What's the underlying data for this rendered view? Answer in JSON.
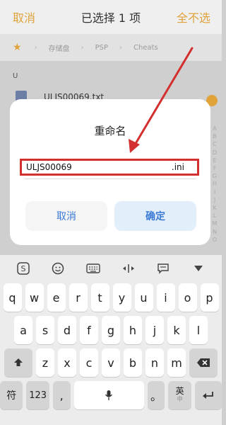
{
  "topbar": {
    "cancel": "取消",
    "title": "已选择 1 项",
    "deselect_all": "全不选"
  },
  "breadcrumb": {
    "items": [
      "存储盘",
      "PSP",
      "Cheats"
    ],
    "separator": "›"
  },
  "section_letter": "U",
  "file": {
    "name": "ULJS00069.txt"
  },
  "alphabet": [
    "A",
    "B",
    "C",
    "D",
    "E",
    "F",
    "G",
    "H",
    "I",
    "J",
    "K",
    "L",
    "M",
    "N",
    "O"
  ],
  "dialog": {
    "title": "重命名",
    "input_value": "ULJS00069",
    "extension": ".ini",
    "cancel": "取消",
    "confirm": "确定"
  },
  "keyboard": {
    "row1": [
      "q",
      "w",
      "e",
      "r",
      "t",
      "y",
      "u",
      "i",
      "o",
      "p"
    ],
    "row2": [
      "a",
      "s",
      "d",
      "f",
      "g",
      "h",
      "j",
      "k",
      "l"
    ],
    "row3": [
      "z",
      "x",
      "c",
      "v",
      "b",
      "n",
      "m"
    ],
    "symbols_key": "符",
    "numbers_key": "123",
    "comma": ",",
    "period": "。",
    "lang_key": "英",
    "lang_sub": "中",
    "mic_icon": "🎤"
  },
  "colors": {
    "accent": "#e0a33a",
    "highlight": "#d32f2f",
    "link": "#3a7bd5"
  }
}
